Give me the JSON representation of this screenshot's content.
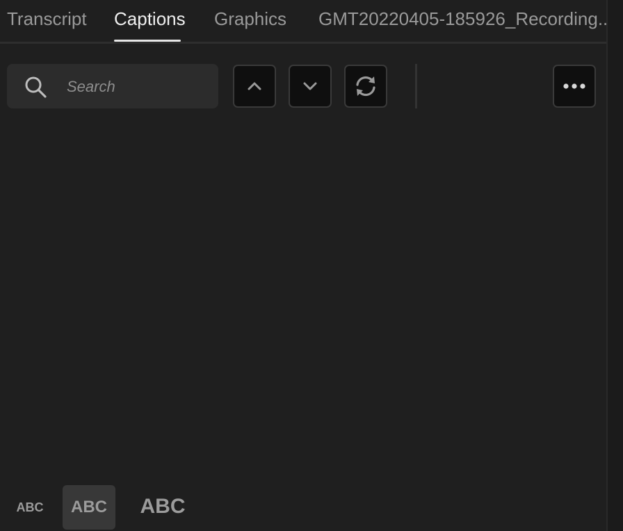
{
  "tabs": [
    {
      "label": "Transcript",
      "active": false
    },
    {
      "label": "Captions",
      "active": true
    },
    {
      "label": "Graphics",
      "active": false
    },
    {
      "label": "GMT20220405-185926_Recording...",
      "active": false
    }
  ],
  "toolbar": {
    "search_placeholder": "Search",
    "search_value": "",
    "previous_icon": "chevron-up-icon",
    "next_icon": "chevron-down-icon",
    "refresh_icon": "refresh-icon",
    "more_icon": "more-options-icon"
  },
  "text_size_options": [
    {
      "label": "ABC",
      "size": "small",
      "selected": false
    },
    {
      "label": "ABC",
      "size": "medium",
      "selected": true
    },
    {
      "label": "ABC",
      "size": "large",
      "selected": false
    }
  ],
  "colors": {
    "background": "#1f1f1f",
    "active_tab": "#f0f0f0",
    "inactive_tab": "#9a9a9a",
    "button_bg": "#0f0f0f"
  }
}
